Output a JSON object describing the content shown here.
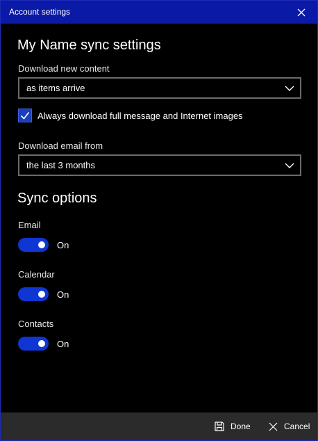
{
  "window": {
    "title": "Account settings"
  },
  "sync_settings": {
    "heading": "My Name sync settings",
    "download_new_content": {
      "label": "Download new content",
      "value": "as items arrive"
    },
    "always_download_full": {
      "checked": true,
      "label": "Always download full message and Internet images"
    },
    "download_email_from": {
      "label": "Download email from",
      "value": "the last 3 months"
    }
  },
  "sync_options": {
    "heading": "Sync options",
    "items": [
      {
        "label": "Email",
        "state": "On"
      },
      {
        "label": "Calendar",
        "state": "On"
      },
      {
        "label": "Contacts",
        "state": "On"
      }
    ]
  },
  "footer": {
    "done_label": "Done",
    "cancel_label": "Cancel"
  },
  "colors": {
    "titlebar": "#0a1aa6",
    "accent": "#0f36d2",
    "footer": "#2b2b2b"
  }
}
